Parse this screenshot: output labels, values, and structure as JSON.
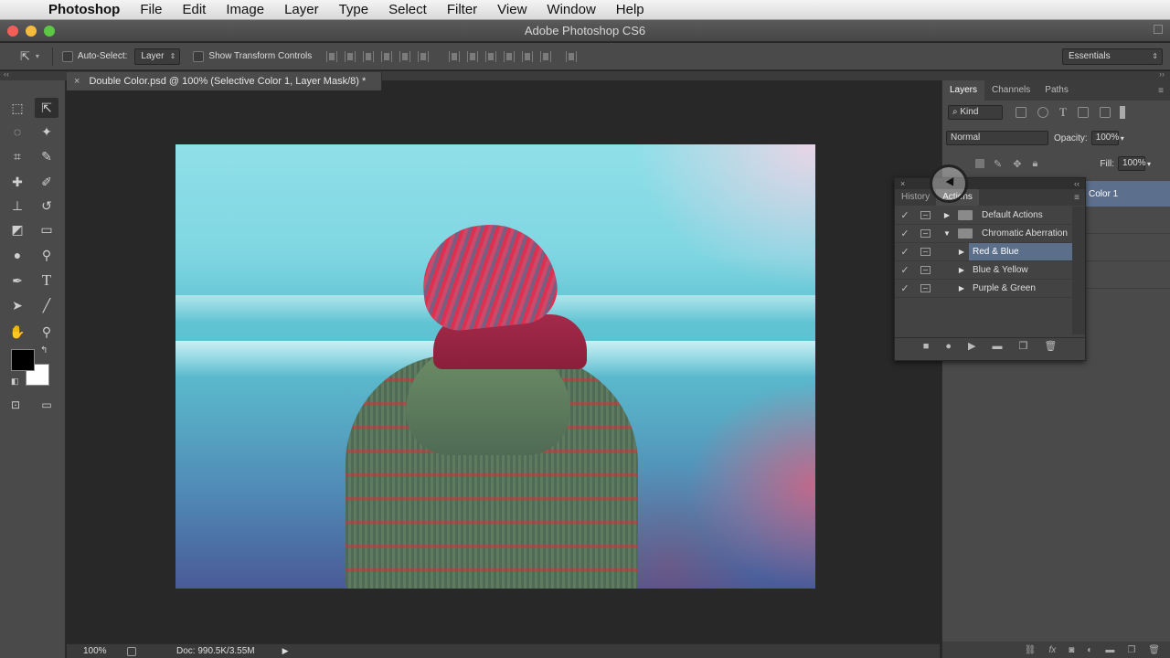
{
  "menubar": {
    "app": "Photoshop",
    "items": [
      "File",
      "Edit",
      "Image",
      "Layer",
      "Type",
      "Select",
      "Filter",
      "View",
      "Window",
      "Help"
    ]
  },
  "window": {
    "title": "Adobe Photoshop CS6"
  },
  "options": {
    "auto_select_label": "Auto-Select:",
    "auto_select_value": "Layer",
    "transform_label": "Show Transform Controls",
    "workspace": "Essentials"
  },
  "document": {
    "tab_title": "Double Color.psd @ 100% (Selective Color 1, Layer Mask/8) *",
    "zoom": "100%",
    "doc_size": "Doc: 990.5K/3.55M"
  },
  "layers_panel": {
    "tabs": [
      "Layers",
      "Channels",
      "Paths"
    ],
    "kind": "Kind",
    "blend_mode": "Normal",
    "opacity_label": "Opacity:",
    "opacity": "100%",
    "fill_label": "Fill:",
    "fill": "100%",
    "selected_layer": "Color 1"
  },
  "actions_panel": {
    "tabs": [
      "History",
      "Actions"
    ],
    "rows": [
      {
        "label": "Default Actions",
        "type": "set",
        "expanded": false
      },
      {
        "label": "Chromatic Aberration",
        "type": "set",
        "expanded": true
      },
      {
        "label": "Red & Blue",
        "type": "action",
        "selected": true
      },
      {
        "label": "Blue & Yellow",
        "type": "action"
      },
      {
        "label": "Purple & Green",
        "type": "action"
      }
    ]
  }
}
